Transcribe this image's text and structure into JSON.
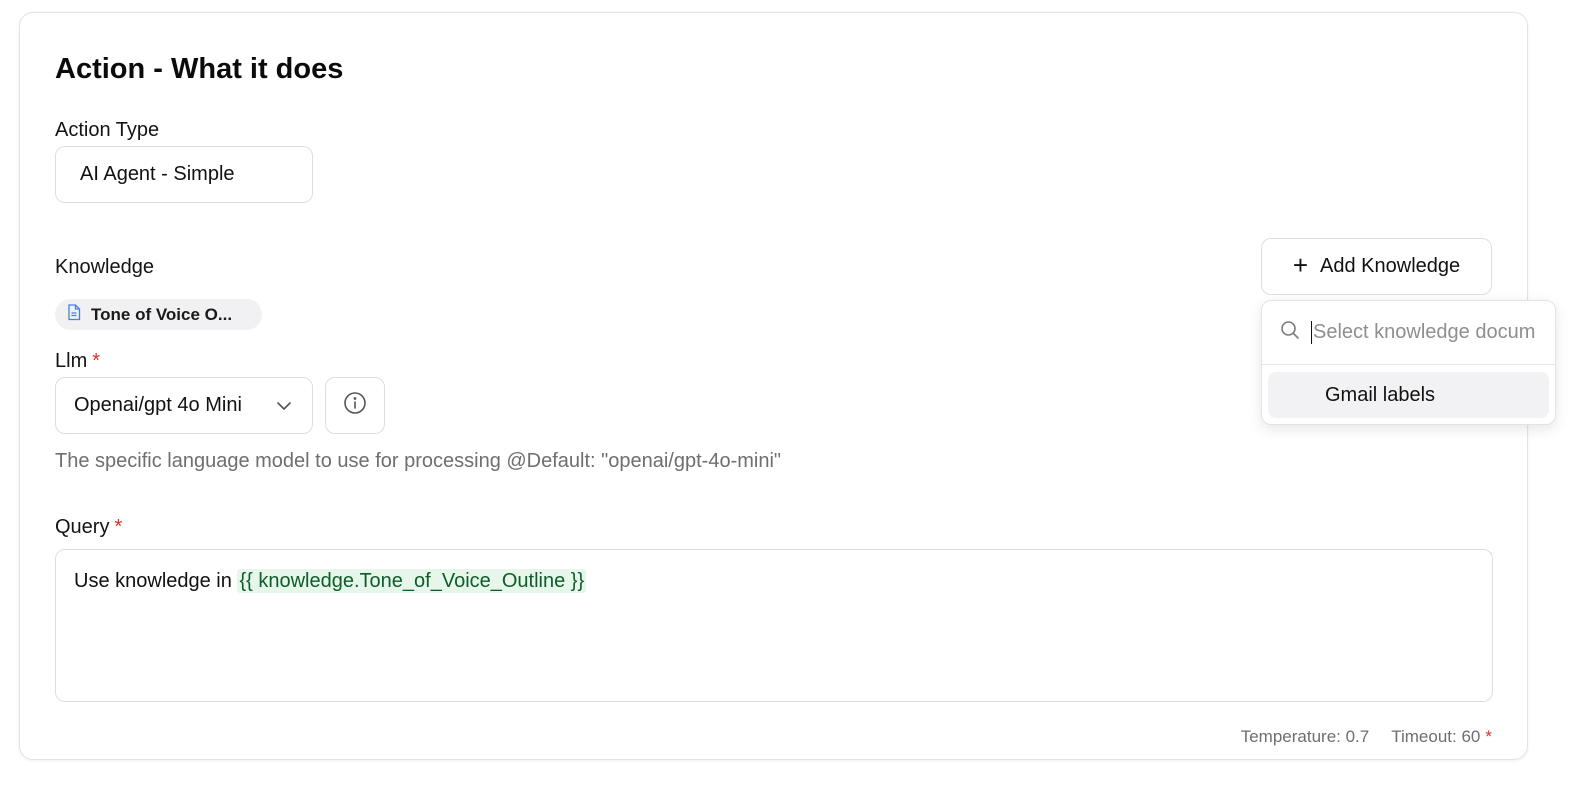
{
  "section": {
    "title": "Action - What it does"
  },
  "action_type": {
    "label": "Action Type",
    "value": "AI Agent - Simple"
  },
  "knowledge": {
    "label": "Knowledge",
    "add_button_label": "Add Knowledge",
    "chip_label": "Tone of Voice O...",
    "search_placeholder": "Select knowledge docum",
    "options": [
      "Gmail labels"
    ]
  },
  "llm": {
    "label": "Llm",
    "required_mark": "*",
    "value": "Openai/gpt 4o Mini",
    "help_text": "The specific language model to use for processing @Default: \"openai/gpt-4o-mini\""
  },
  "query": {
    "label": "Query",
    "required_mark": "*",
    "text_prefix": "Use knowledge in ",
    "variable": "{{ knowledge.Tone_of_Voice_Outline }}"
  },
  "footer": {
    "temperature": "Temperature: 0.7",
    "timeout": "Timeout: 60",
    "timeout_required_mark": "*"
  },
  "colors": {
    "required": "#d93025",
    "variable_bg": "#e6f6ea",
    "doc_icon": "#4a7fe0"
  },
  "icons": {
    "add": "plus-icon",
    "chip": "document-icon",
    "select": "chevron-down-icon",
    "info": "info-icon",
    "search": "search-icon"
  }
}
